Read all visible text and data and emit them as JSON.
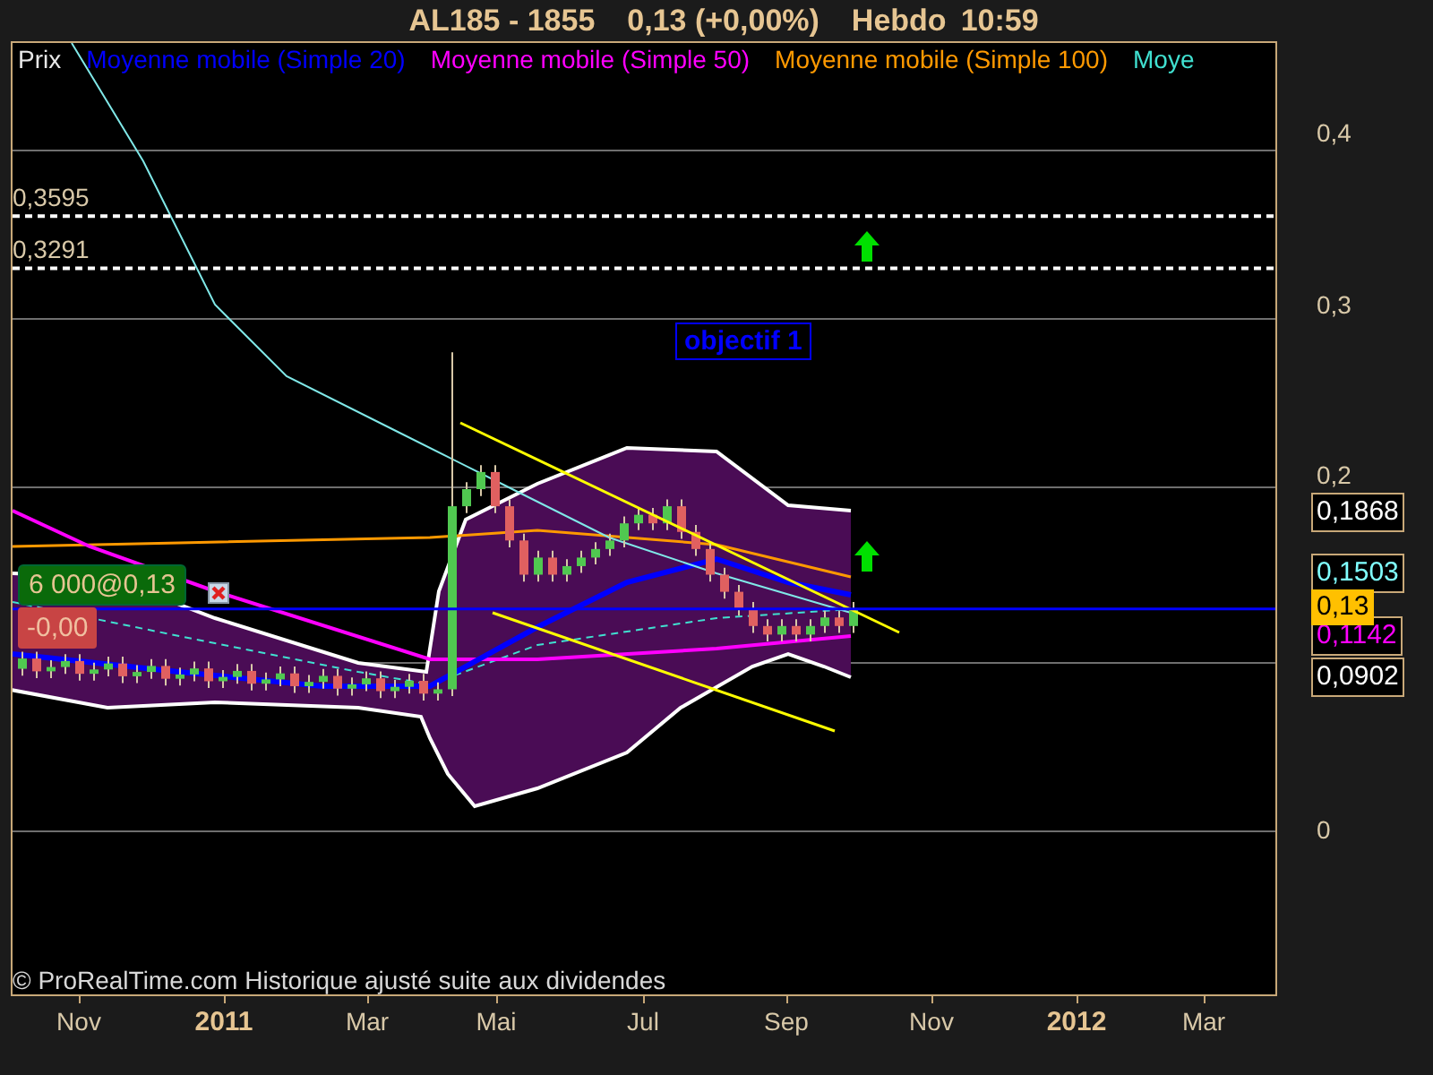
{
  "title": {
    "symbol": "AL185 - 1855",
    "quote": "0,13 (+0,00%)",
    "period": "Hebdo",
    "time": "10:59"
  },
  "legend": [
    {
      "label": "Prix",
      "color": "#e8e8e8"
    },
    {
      "label": "Moyenne mobile (Simple 20)",
      "color": "#0000ff"
    },
    {
      "label": "Moyenne mobile (Simple 50)",
      "color": "#ff00ff"
    },
    {
      "label": "Moyenne mobile (Simple 100)",
      "color": "#ff9900"
    },
    {
      "label": "Moye",
      "color": "#40e0d0"
    }
  ],
  "levels": [
    {
      "label": "0,3595"
    },
    {
      "label": "0,3291"
    }
  ],
  "annotation": {
    "label": "objectif 1"
  },
  "order": {
    "label": "6 000@0,13",
    "pnl": "-0,00"
  },
  "footer": "© ProRealTime.com Historique ajusté suite aux dividendes",
  "y_axis": {
    "ticks": [
      "0,4",
      "0,3",
      "0,2",
      "0"
    ],
    "price_tags": [
      {
        "label": "0,1868",
        "color": "#ffffff",
        "kind": "outline"
      },
      {
        "label": "0,1503",
        "color": "#80ffff",
        "kind": "outline"
      },
      {
        "label": "0,13",
        "color": "#ffc000",
        "kind": "filled"
      },
      {
        "label": "0,1142",
        "color": "#ff00ff",
        "kind": "outline"
      },
      {
        "label": "0,0902",
        "color": "#ffffff",
        "kind": "outline"
      }
    ]
  },
  "x_axis": [
    {
      "label": "Nov",
      "kind": "month"
    },
    {
      "label": "2011",
      "kind": "year"
    },
    {
      "label": "Mar",
      "kind": "month"
    },
    {
      "label": "Mai",
      "kind": "month"
    },
    {
      "label": "Jul",
      "kind": "month"
    },
    {
      "label": "Sep",
      "kind": "month"
    },
    {
      "label": "Nov",
      "kind": "month"
    },
    {
      "label": "2012",
      "kind": "year"
    },
    {
      "label": "Mar",
      "kind": "month"
    }
  ]
}
